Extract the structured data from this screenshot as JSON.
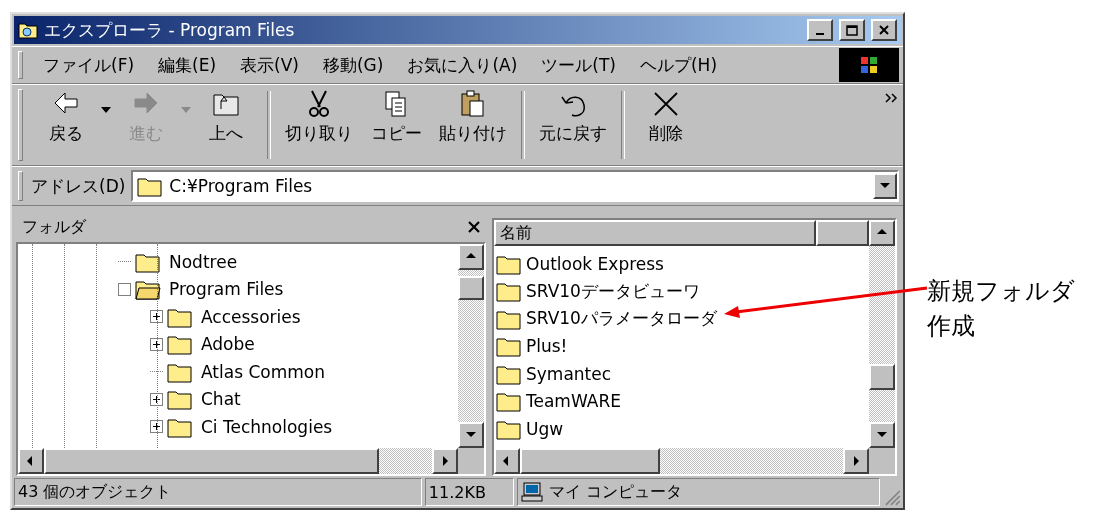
{
  "window": {
    "title": "エクスプローラ - Program Files"
  },
  "menu": [
    "ファイル(F)",
    "編集(E)",
    "表示(V)",
    "移動(G)",
    "お気に入り(A)",
    "ツール(T)",
    "ヘルプ(H)"
  ],
  "toolbar": {
    "groups": [
      [
        {
          "kind": "back",
          "label": "戻る",
          "disabled": false,
          "dropdown": true
        },
        {
          "kind": "forward",
          "label": "進む",
          "disabled": true,
          "dropdown": true
        },
        {
          "kind": "up",
          "label": "上へ",
          "disabled": false,
          "dropdown": false
        }
      ],
      [
        {
          "kind": "cut",
          "label": "切り取り",
          "disabled": false,
          "dropdown": false
        },
        {
          "kind": "copy",
          "label": "コピー",
          "disabled": false,
          "dropdown": false
        },
        {
          "kind": "paste",
          "label": "貼り付け",
          "disabled": false,
          "dropdown": false
        }
      ],
      [
        {
          "kind": "undo",
          "label": "元に戻す",
          "disabled": false,
          "dropdown": false
        }
      ],
      [
        {
          "kind": "delete",
          "label": "削除",
          "disabled": false,
          "dropdown": false
        }
      ]
    ]
  },
  "address": {
    "label": "アドレス(D)",
    "value": "C:¥Program Files"
  },
  "folder_pane": {
    "title": "フォルダ",
    "tree": [
      {
        "label": "Nodtree",
        "expandable": false,
        "expanded": false
      },
      {
        "label": "Program Files",
        "expandable": true,
        "expanded": true,
        "children": [
          {
            "label": "Accessories",
            "expandable": true,
            "expanded": false
          },
          {
            "label": "Adobe",
            "expandable": true,
            "expanded": false
          },
          {
            "label": "Atlas Common",
            "expandable": false,
            "expanded": false
          },
          {
            "label": "Chat",
            "expandable": true,
            "expanded": false
          },
          {
            "label": "Ci Technologies",
            "expandable": true,
            "expanded": false
          }
        ]
      }
    ]
  },
  "file_list": {
    "columns": [
      "名前"
    ],
    "items": [
      "Outlook Express",
      "SRV10データビューワ",
      "SRV10パラメータローダ",
      "Plus!",
      "Symantec",
      "TeamWARE",
      "Ugw"
    ]
  },
  "status_bar": {
    "objects": "43 個のオブジェクト",
    "size": "11.2KB",
    "location": "マイ コンピュータ"
  },
  "annotation": {
    "text": "新規フォルダ作成"
  }
}
